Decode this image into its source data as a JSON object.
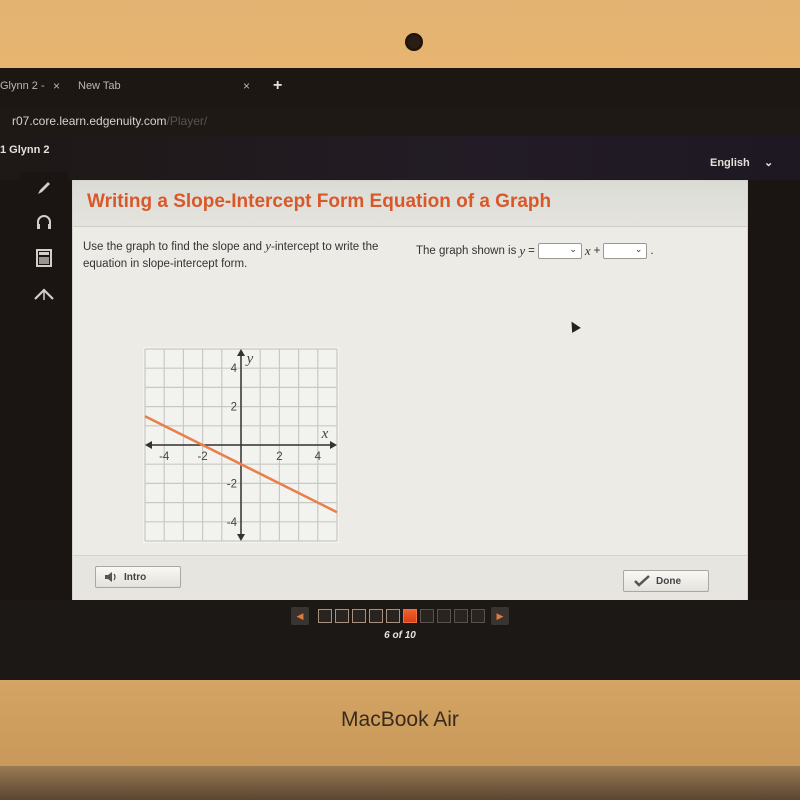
{
  "device": {
    "brand_label": "MacBook Air"
  },
  "browser": {
    "tabs": [
      {
        "label": "Glynn 2 - ",
        "close": "×"
      },
      {
        "label": "New Tab",
        "close": "×"
      }
    ],
    "new_tab_label": "+",
    "url_domain": "r07.core.learn.edgenuity.com",
    "url_path": "/Player/"
  },
  "app": {
    "course_label": "1 Glynn 2",
    "language_label": "English",
    "language_chevron": "⌄"
  },
  "tools": [
    {
      "name": "pencil-icon",
      "glyph": "✎"
    },
    {
      "name": "headphones-icon",
      "glyph": "🎧"
    },
    {
      "name": "calculator-icon",
      "glyph": "▦"
    },
    {
      "name": "collapse-icon",
      "glyph": "⌃"
    }
  ],
  "lesson": {
    "title": "Writing a Slope-Intercept Form Equation of a Graph",
    "instructions_1": "Use the graph to find the slope and ",
    "instructions_var": "y",
    "instructions_2": "-intercept to write the equation in slope-intercept form.",
    "prompt_prefix": "The graph shown is ",
    "prompt_var_y": "y",
    "prompt_equals": " =",
    "prompt_var_x": "x",
    "prompt_plus": "+",
    "prompt_end": ".",
    "slope_select": {
      "value": "",
      "chevron": "⌄"
    },
    "intercept_select": {
      "value": "",
      "chevron": "⌄"
    }
  },
  "chart_data": {
    "type": "line",
    "title": "",
    "xlabel": "x",
    "ylabel": "y",
    "xlim": [
      -5,
      5
    ],
    "ylim": [
      -5,
      5
    ],
    "grid": true,
    "x_ticks": [
      -4,
      -2,
      2,
      4
    ],
    "y_ticks": [
      4,
      2,
      -2,
      -4
    ],
    "series": [
      {
        "name": "line",
        "color": "#e8804a",
        "x": [
          -5,
          5
        ],
        "y": [
          1.5,
          -3.5
        ]
      }
    ],
    "points_on_line": [
      [
        -2,
        0
      ],
      [
        0,
        -1
      ]
    ]
  },
  "footer": {
    "intro_label": "Intro",
    "done_label": "Done"
  },
  "pager": {
    "prev_glyph": "◀",
    "next_glyph": "▶",
    "current": 6,
    "total": 10,
    "count_label": "6 of 10"
  },
  "colors": {
    "title_orange": "#d9582a",
    "accent_orange": "#e8804a"
  }
}
